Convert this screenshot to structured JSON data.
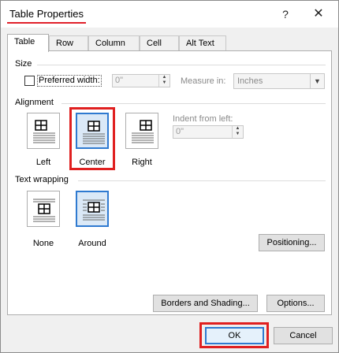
{
  "window": {
    "title": "Table Properties",
    "help_glyph": "?",
    "close_glyph": "✕"
  },
  "tabs": [
    {
      "label": "Table"
    },
    {
      "label": "Row"
    },
    {
      "label": "Column"
    },
    {
      "label": "Cell"
    },
    {
      "label": "Alt Text"
    }
  ],
  "size": {
    "section_label": "Size",
    "preferred_width_label": "Preferred width:",
    "preferred_width_checked": false,
    "width_value": "0\"",
    "measure_in_label": "Measure in:",
    "measure_in_value": "Inches"
  },
  "alignment": {
    "section_label": "Alignment",
    "options": [
      {
        "label": "Left",
        "selected": false
      },
      {
        "label": "Center",
        "selected": true
      },
      {
        "label": "Right",
        "selected": false
      }
    ],
    "indent_label": "Indent from left:",
    "indent_value": "0\""
  },
  "text_wrapping": {
    "section_label": "Text wrapping",
    "options": [
      {
        "label": "None",
        "selected": false
      },
      {
        "label": "Around",
        "selected": true
      }
    ],
    "positioning_button": "Positioning..."
  },
  "buttons": {
    "borders_shading": "Borders and Shading...",
    "options": "Options...",
    "ok": "OK",
    "cancel": "Cancel"
  },
  "colors": {
    "highlight_red": "#e02020",
    "selected_blue": "#2f7ad0"
  }
}
